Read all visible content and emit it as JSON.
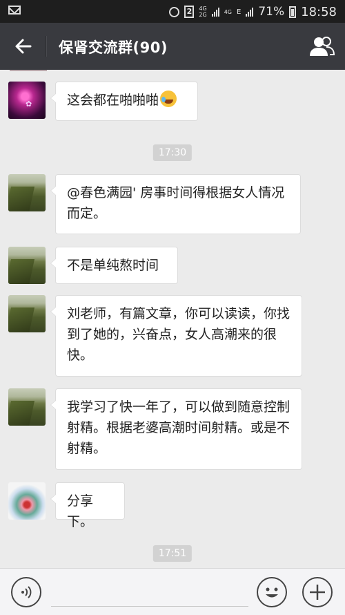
{
  "status_bar": {
    "sim_slot": "2",
    "net_top": "4G",
    "net_bottom": "2G",
    "net2_top": "4G",
    "net_e": "E",
    "battery_pct": "71%",
    "time": "18:58"
  },
  "header": {
    "title": "保肾交流群(90)"
  },
  "messages": [
    {
      "text": "这会都在啪啪啪",
      "avatar": "purple-avatar",
      "emoji": "laughing-crying-emoji"
    },
    {
      "text": "@春色满园' 房事时间得根据女人情况而定。",
      "avatar": "landscape-avatar"
    },
    {
      "text": "不是单纯熬时间",
      "avatar": "landscape-avatar"
    },
    {
      "text": "刘老师，有篇文章，你可以读读，你找到了她的，兴奋点，女人高潮来的很快。",
      "avatar": "landscape-avatar"
    },
    {
      "text": "我学习了快一年了，可以做到随意控制射精。根据老婆高潮时间射精。或是不射精。",
      "avatar": "landscape-avatar"
    },
    {
      "text": "分享下。",
      "avatar": "sphere-avatar"
    }
  ],
  "timestamps": [
    "17:30",
    "17:51"
  ],
  "input_bar": {
    "icons": [
      "voice-icon",
      "emoji-icon",
      "plus-icon"
    ]
  }
}
